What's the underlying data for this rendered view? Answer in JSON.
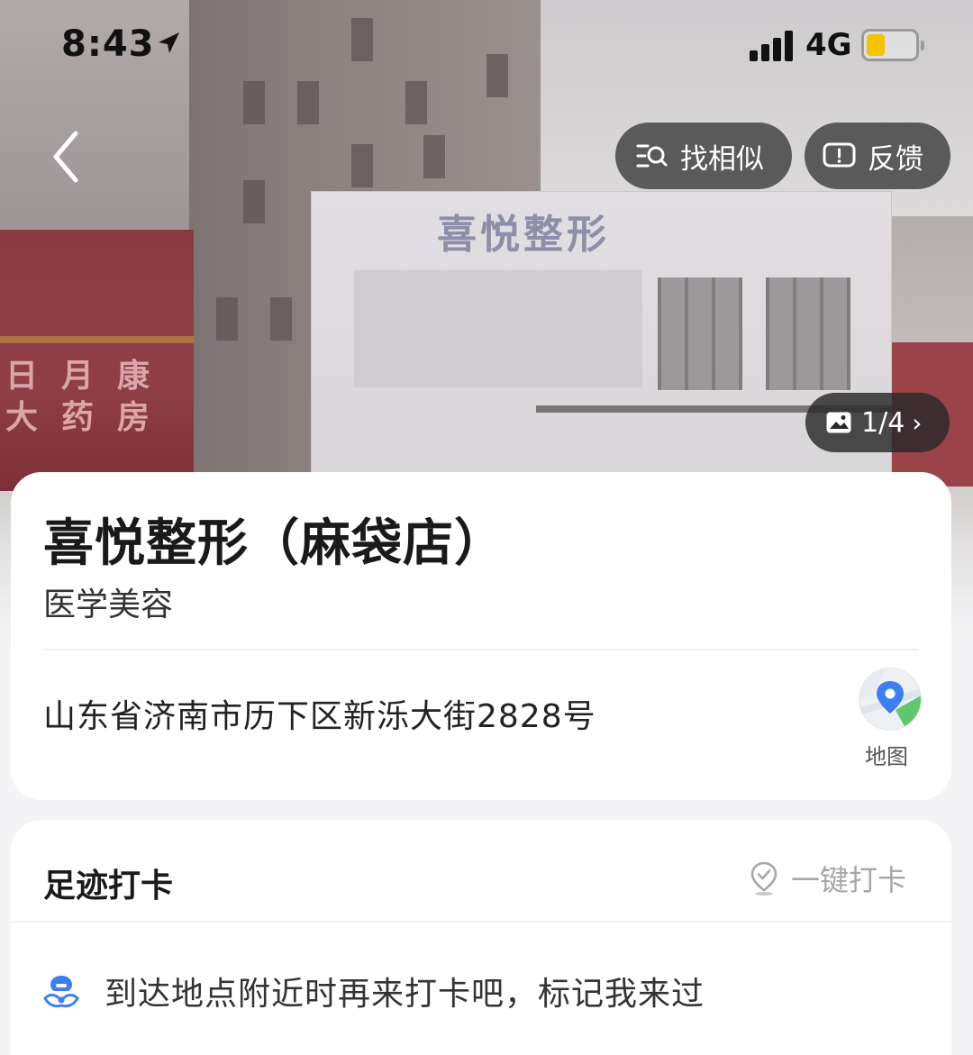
{
  "status_bar": {
    "time": "8:43",
    "network": "4G",
    "colors": {
      "battery": "#f2c400"
    }
  },
  "top_actions": {
    "similar_label": "找相似",
    "feedback_label": "反馈"
  },
  "hero": {
    "storefront_sign": "喜悦整形",
    "neighbor_sign_lines": [
      "日月康",
      "大药房"
    ],
    "photo_counter": "1/4"
  },
  "place": {
    "name": "喜悦整形（麻袋店）",
    "category": "医学美容",
    "address": "山东省济南市历下区新泺大街2828号",
    "map_label": "地图"
  },
  "checkin": {
    "title": "足迹打卡",
    "action_label": "一键打卡",
    "hint": "到达地点附近时再来打卡吧，标记我来过"
  },
  "icons": {
    "back": "chevron-left-icon",
    "similar": "image-search-icon",
    "feedback": "feedback-icon",
    "photo": "photo-icon",
    "map": "map-pin-icon",
    "checkin": "location-check-icon",
    "hint": "footprint-icon"
  },
  "colors": {
    "accent_blue": "#3d7ff0",
    "card_bg": "#ffffff",
    "page_bg": "#f4f4f6"
  }
}
